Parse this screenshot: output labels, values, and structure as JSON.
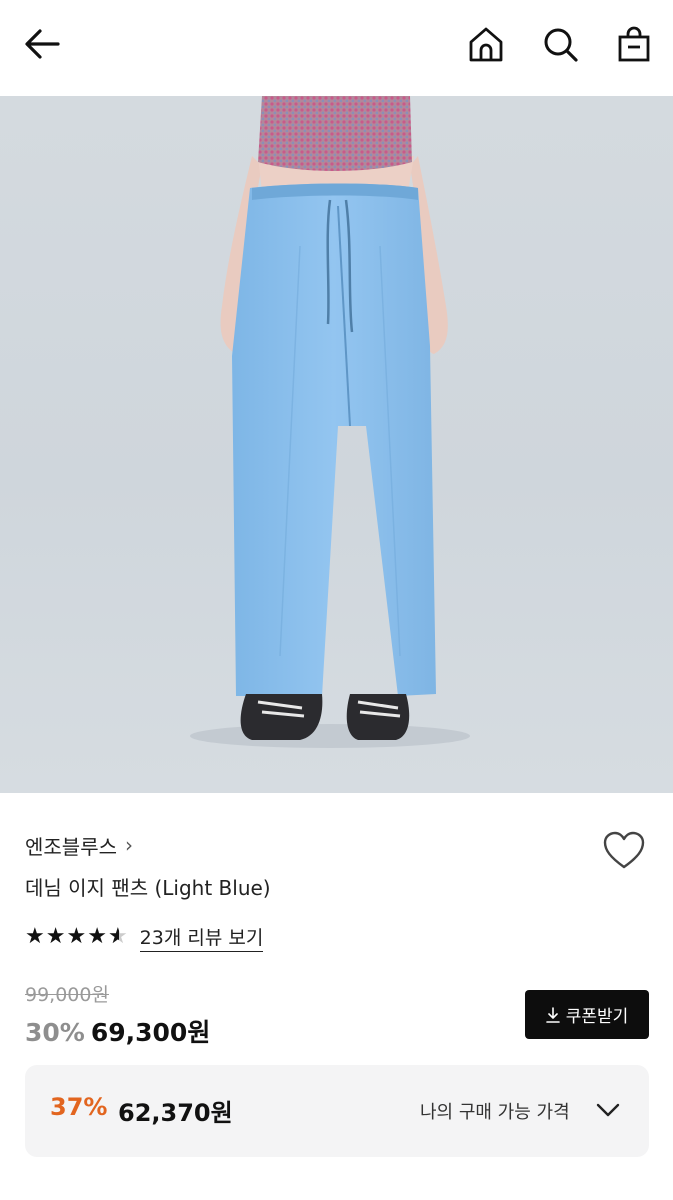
{
  "header": {
    "icons": [
      "back-arrow-icon",
      "home-icon",
      "search-icon",
      "shopping-bag-icon"
    ]
  },
  "product": {
    "brand": "엔조블루스",
    "brand_chevron": "›",
    "title": "데님 이지 팬츠 (Light Blue)",
    "rating": 4.5,
    "review_link": "23개 리뷰 보기",
    "original_price": "99,000원",
    "discount_pct": "30%",
    "sale_price": "69,300원",
    "coupon_button": "쿠폰받기",
    "my_price": {
      "discount_pct": "37%",
      "price": "62,370원",
      "label": "나의 구매 가능 가격"
    }
  },
  "colors": {
    "accent_orange": "#e2651f",
    "button_black": "#0d0d0d",
    "panel_bg": "#f4f4f5"
  }
}
